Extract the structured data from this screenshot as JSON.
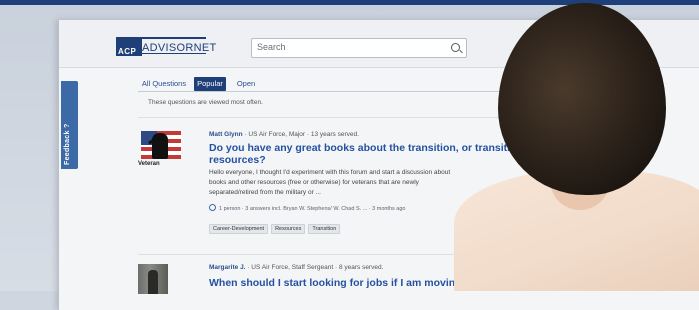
{
  "header": {
    "logo_acp": "ACP",
    "logo_name": "ADVISORNET",
    "search_placeholder": "Search"
  },
  "feedback_tab": {
    "label": "Feedback ?"
  },
  "tabs": [
    {
      "label": "All Questions",
      "active": false
    },
    {
      "label": "Popular",
      "active": true
    },
    {
      "label": "Open",
      "active": false
    }
  ],
  "tab_subtitle": "These questions are viewed most often.",
  "posts": [
    {
      "author_name": "Matt Glynn",
      "author_info": " · US Air Force, Major · 13 years served.",
      "avatar_label": "Veteran",
      "title_line1": "Do you have any great books about the transition, or transition",
      "title_line2": "resources?",
      "excerpt_line1": "Hello everyone, I thought I'd experiment with this forum and start a discussion about",
      "excerpt_line2": "books and other resources (free or otherwise) for veterans that are newly",
      "excerpt_line3": "separated/retired from the military or ...",
      "meta": "1 person · 3 answers incl. Bryan W. Stephens/ W. Chad S. ... · 3 months ago",
      "tags": [
        "Career-Development",
        "Resources",
        "Transition"
      ]
    },
    {
      "author_name": "Margarite J.",
      "author_info": " · US Air Force, Staff Sergeant · 8 years served.",
      "title_line1": "When should I start looking for jobs if I am moving to a"
    }
  ],
  "colors": {
    "brand": "#1f3f78",
    "link": "#2451a0",
    "feedback": "#3b6aa6"
  }
}
